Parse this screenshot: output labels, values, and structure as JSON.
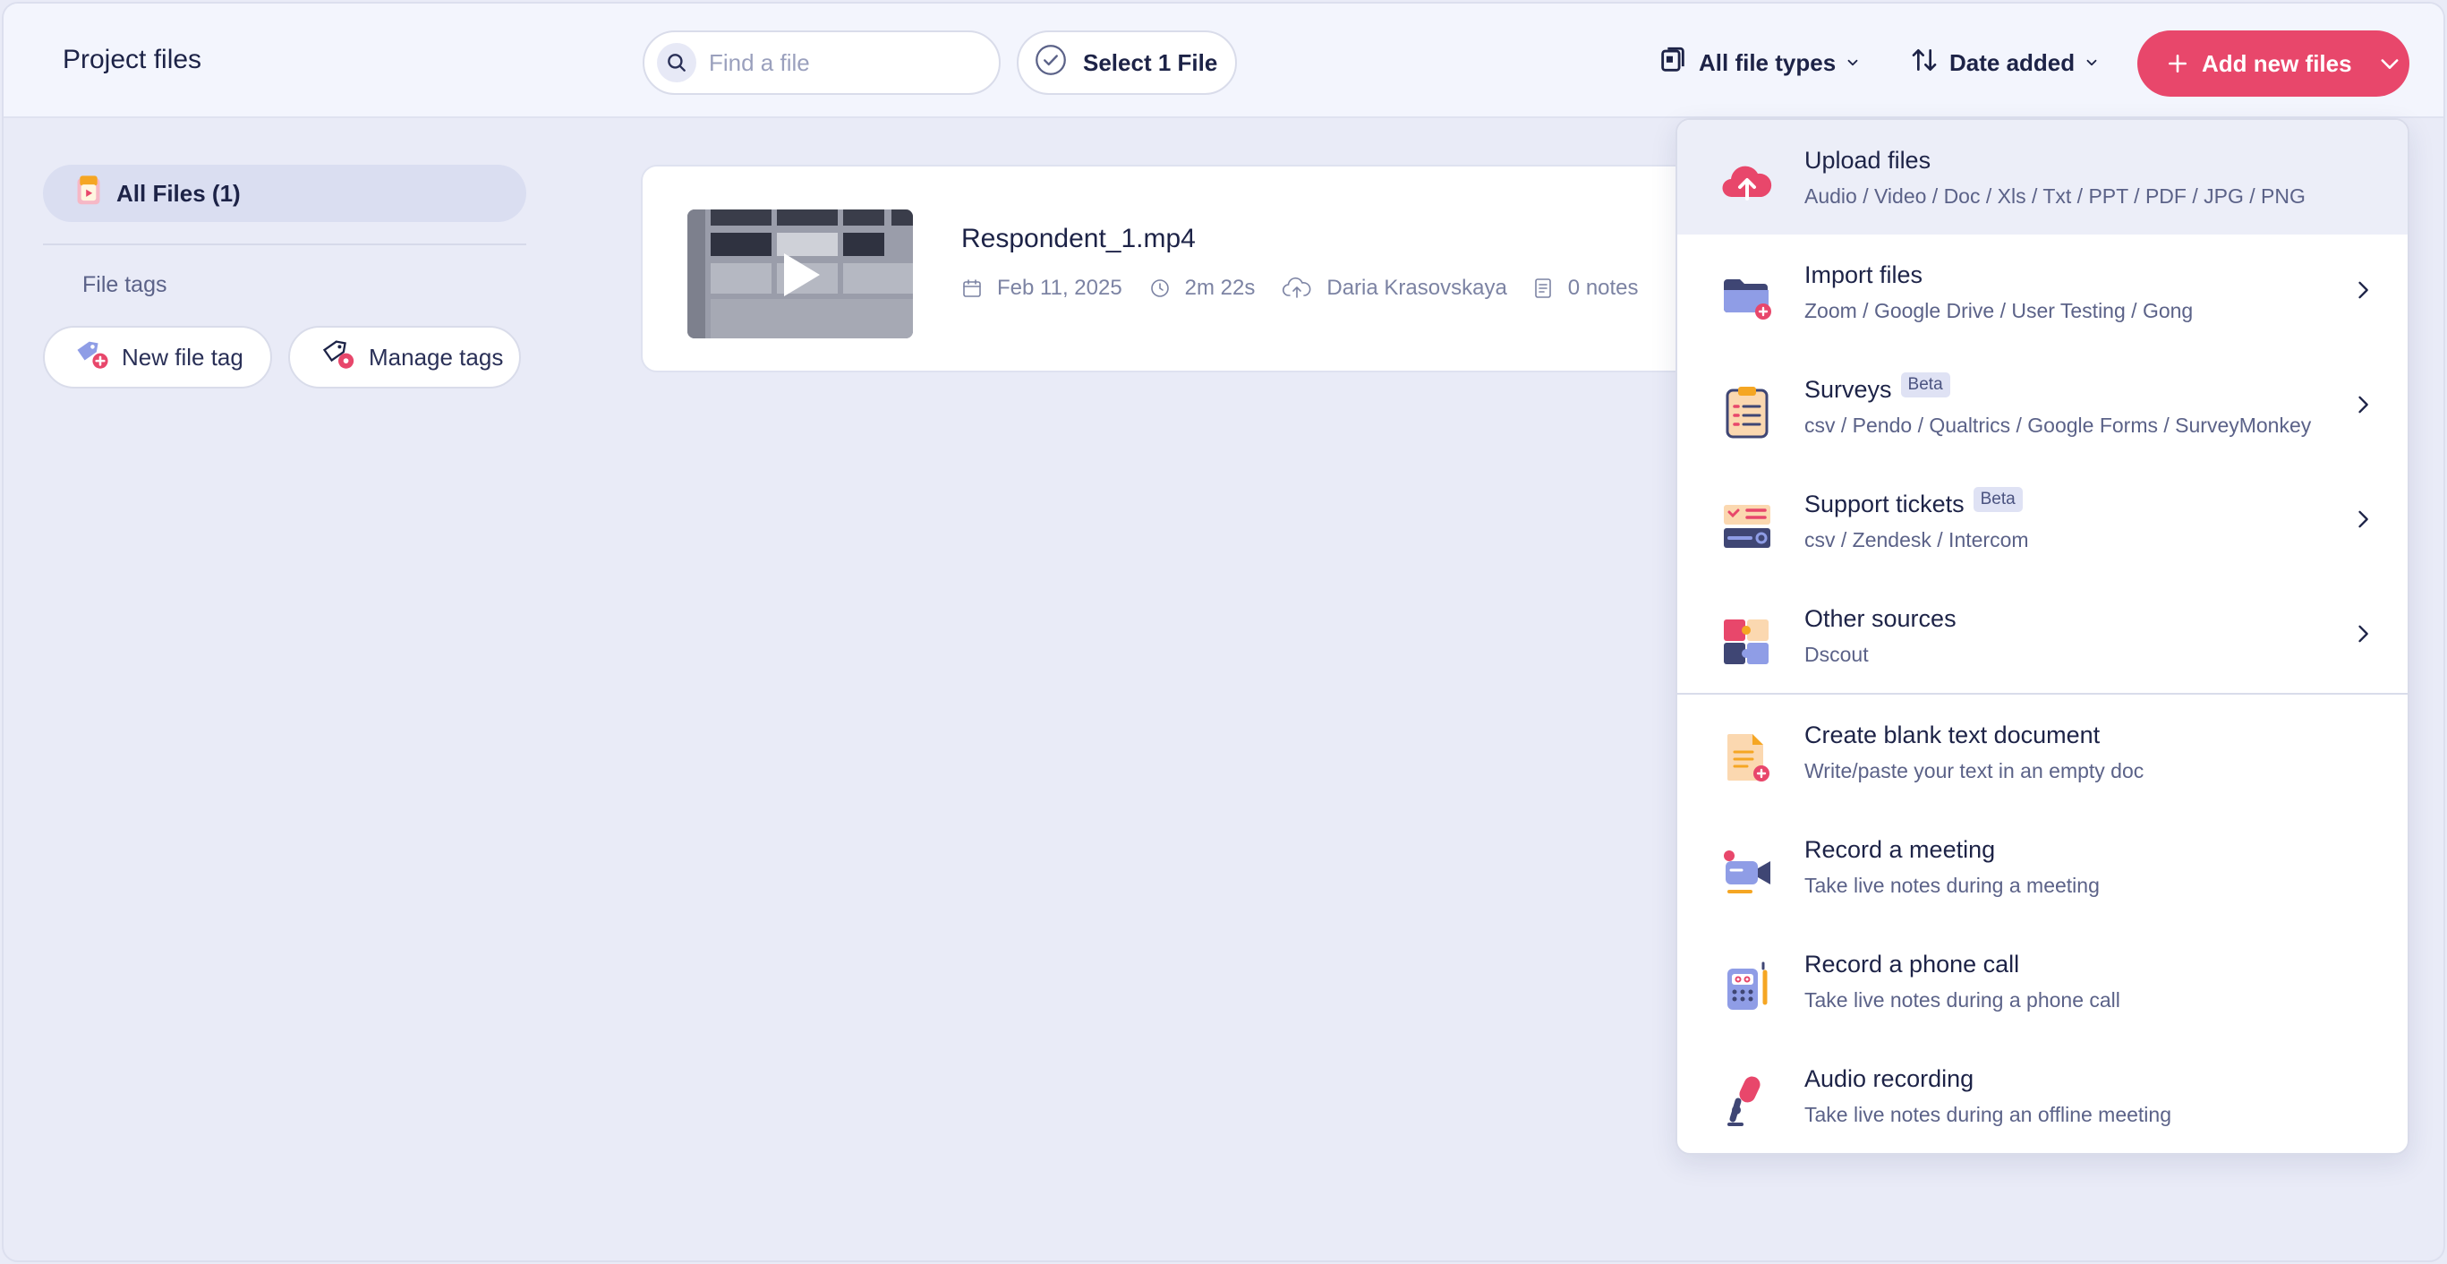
{
  "header": {
    "title": "Project files",
    "search_placeholder": "Find a file",
    "select_label": "Select 1 File",
    "file_types_label": "All file types",
    "sort_label": "Date added",
    "add_label": "Add new files"
  },
  "sidebar": {
    "all_files_label": "All Files (1)",
    "file_tags_label": "File tags",
    "new_tag_label": "New file tag",
    "manage_tags_label": "Manage tags"
  },
  "file": {
    "name": "Respondent_1.mp4",
    "date": "Feb 11, 2025",
    "duration": "2m 22s",
    "uploader": "Daria Krasovskaya",
    "notes": "0 notes"
  },
  "menu": {
    "items": [
      {
        "title": "Upload files",
        "subtitle": "Audio / Video / Doc / Xls / Txt / PPT / PDF / JPG / PNG",
        "icon": "cloud-upload-icon"
      },
      {
        "title": "Import files",
        "subtitle": "Zoom / Google Drive / User Testing / Gong",
        "icon": "folder-import-icon"
      },
      {
        "title": "Surveys",
        "badge": "Beta",
        "subtitle": "csv / Pendo / Qualtrics / Google Forms / SurveyMonkey",
        "icon": "clipboard-icon"
      },
      {
        "title": "Support tickets",
        "badge": "Beta",
        "subtitle": "csv / Zendesk / Intercom",
        "icon": "ticket-icon"
      },
      {
        "title": "Other sources",
        "subtitle": "Dscout",
        "icon": "puzzle-icon"
      },
      {
        "title": "Create blank text document",
        "subtitle": "Write/paste your text in an empty doc",
        "icon": "document-add-icon"
      },
      {
        "title": "Record a meeting",
        "subtitle": "Take live notes during a meeting",
        "icon": "video-camera-icon"
      },
      {
        "title": "Record a phone call",
        "subtitle": "Take live notes during a phone call",
        "icon": "phone-icon"
      },
      {
        "title": "Audio recording",
        "subtitle": "Take live notes during an offline meeting",
        "icon": "microphone-icon"
      }
    ]
  },
  "colors": {
    "accent": "#e8476b",
    "background": "#e9ebf7",
    "header_bg": "#f3f5fd",
    "text_primary": "#1d2347",
    "text_secondary": "#5b6288"
  }
}
